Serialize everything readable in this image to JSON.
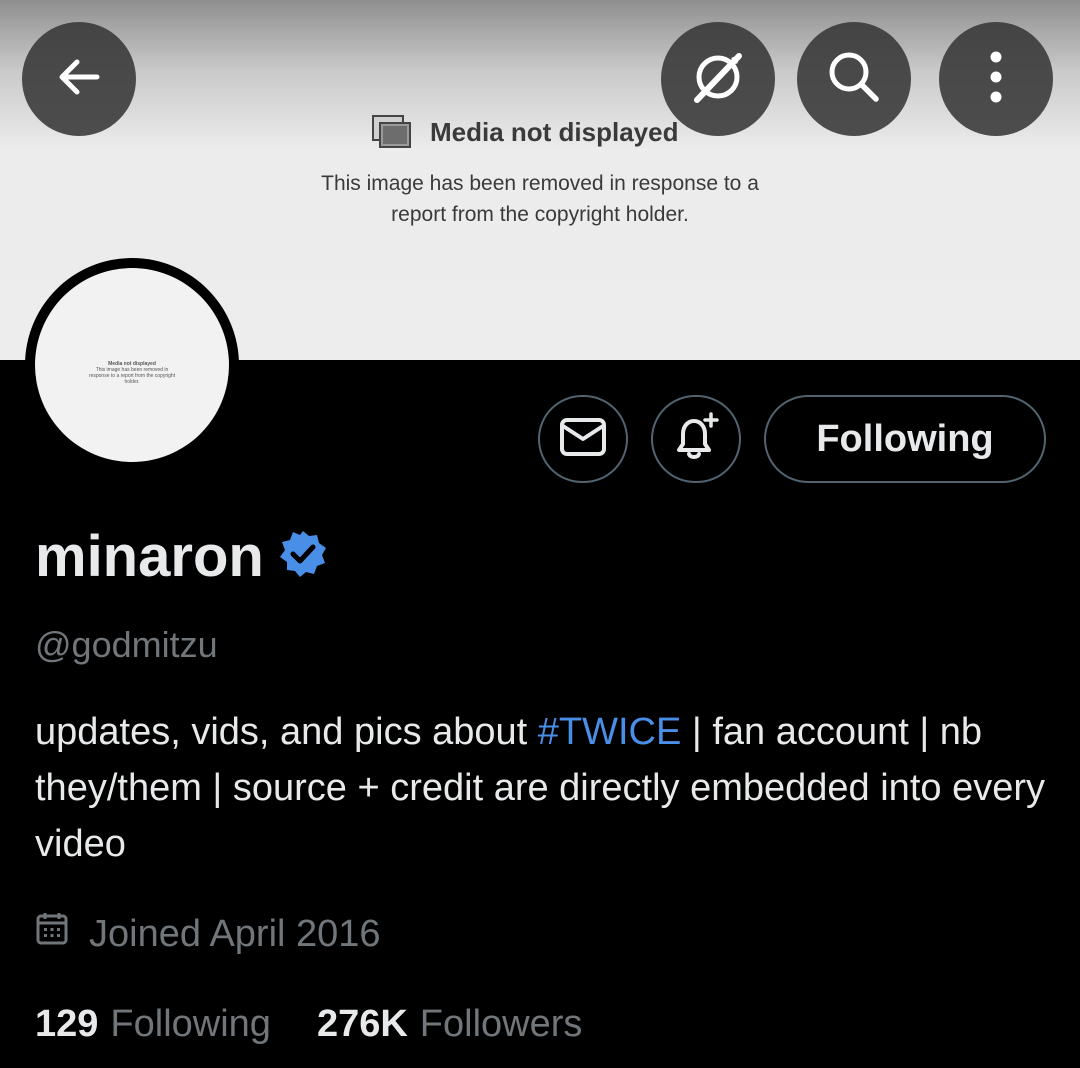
{
  "banner": {
    "media_title": "Media not displayed",
    "media_desc_line1": "This image has been removed in response to a",
    "media_desc_line2": "report from the copyright holder."
  },
  "avatar": {
    "placeholder_title": "Media not displayed",
    "placeholder_desc": "This image has been removed in response to a report from the copyright holder."
  },
  "header_buttons": {
    "back_icon": "arrow-left-icon",
    "grok_icon": "grok-icon",
    "search_icon": "search-icon",
    "more_icon": "more-vertical-icon"
  },
  "actions": {
    "message_icon": "envelope-icon",
    "notify_icon": "bell-plus-icon",
    "following_label": "Following"
  },
  "profile": {
    "display_name": "minaron",
    "verified_icon": "verified-badge-icon",
    "handle": "@godmitzu",
    "bio_before": "updates, vids, and pics about ",
    "bio_hashtag": "#TWICE",
    "bio_after": " | fan account | nb they/them | source + credit are directly embedded into every video",
    "joined": "Joined April 2016",
    "following_count": "129",
    "following_label": "Following",
    "followers_count": "276K",
    "followers_label": "Followers"
  },
  "colors": {
    "background": "#000000",
    "text_primary": "#e7e9ea",
    "text_secondary": "#71767b",
    "accent_blue": "#4a8fe7",
    "verified_blue": "#4a8fe7",
    "button_border": "#536471"
  }
}
